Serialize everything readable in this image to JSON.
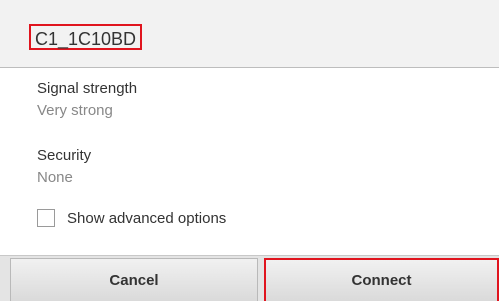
{
  "dialog": {
    "title": "C1_1C10BD",
    "signal": {
      "label": "Signal strength",
      "value": "Very strong"
    },
    "security": {
      "label": "Security",
      "value": "None"
    },
    "advanced": {
      "label": "Show advanced options",
      "checked": false
    },
    "buttons": {
      "cancel": "Cancel",
      "connect": "Connect"
    }
  },
  "colors": {
    "highlight_border": "#e0141e",
    "header_bg": "#f2f2f2",
    "secondary_text": "#888888"
  }
}
